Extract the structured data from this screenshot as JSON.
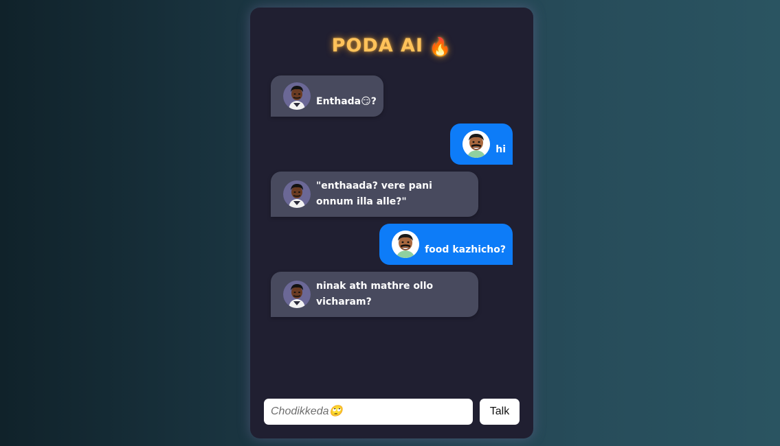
{
  "app": {
    "title": "PODA AI",
    "title_emoji": "🔥"
  },
  "messages": [
    {
      "sender": "bot",
      "text": "Enthada😏?"
    },
    {
      "sender": "user",
      "text": "hi"
    },
    {
      "sender": "bot",
      "text": "\"enthaada? vere pani onnum illa alle?\""
    },
    {
      "sender": "user",
      "text": "food kazhicho?"
    },
    {
      "sender": "bot",
      "text": "ninak ath mathre ollo vicharam?"
    }
  ],
  "composer": {
    "placeholder": "Chodikkeda🙄",
    "value": "",
    "send_label": "Talk"
  },
  "colors": {
    "window_bg": "#201f31",
    "bot_bubble": "#484a5e",
    "user_bubble": "#0d7cf8",
    "title": "#ffc25a"
  },
  "icons": {
    "bot_avatar": "bot-avatar-caricature",
    "user_avatar": "user-avatar-caricature"
  }
}
